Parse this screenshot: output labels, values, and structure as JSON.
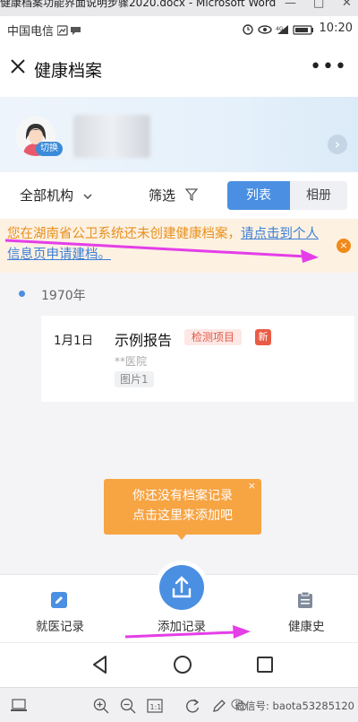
{
  "word_strip": {
    "doc_title": "健康档案功能界面说明步骤2020.docx - Microsoft Word",
    "min": "—",
    "max": "□",
    "close": "✕"
  },
  "status": {
    "carrier": "中国电信",
    "time": "10:20"
  },
  "titlebar": {
    "title": "健康档案",
    "more": "•••"
  },
  "profile": {
    "switch_label": "切换",
    "arrow": "›"
  },
  "filters": {
    "all_orgs": "全部机构",
    "filter": "筛选",
    "list": "列表",
    "album": "相册"
  },
  "notice": {
    "text": "您在湖南省公卫系统还未创建健康档案，",
    "link": "请点击到个人信息页申请建档。",
    "close": "×"
  },
  "timeline": {
    "year": "1970年"
  },
  "record": {
    "date": "1月1日",
    "name": "示例报告",
    "tag": "检测项目",
    "new": "新",
    "hospital": "**医院",
    "pic": "图片1"
  },
  "popup": {
    "line1": "你还没有档案记录",
    "line2": "点击这里来添加吧",
    "close": "×"
  },
  "tabs": {
    "visit": "就医记录",
    "add": "添加记录",
    "history": "健康史"
  },
  "wordbar": {
    "watermark": "微信号: baota53285120"
  },
  "colors": {
    "accent": "#4a8fe2",
    "warning": "#e7901e",
    "arrow": "#e43ee8"
  }
}
